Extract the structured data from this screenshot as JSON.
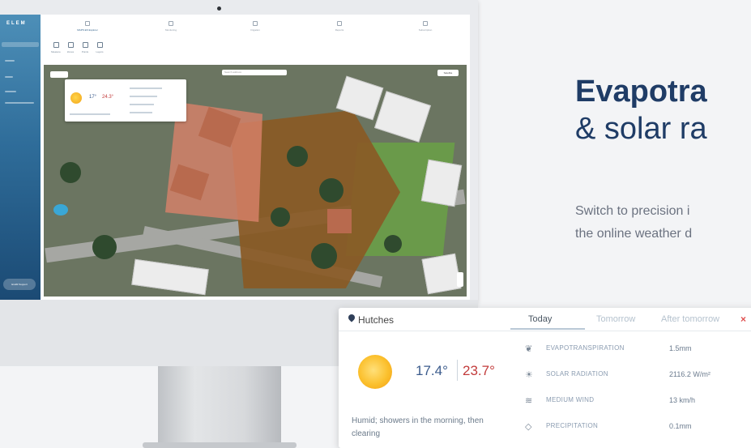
{
  "sidebar": {
    "logo": "ELEM",
    "support_label": "ELEM Support"
  },
  "topnav": {
    "tabs": [
      {
        "label": "MAPS EN Explorer"
      },
      {
        "label": "Monitoring"
      },
      {
        "label": "Irrigation"
      },
      {
        "label": "Reports"
      },
      {
        "label": "Subscription"
      }
    ]
  },
  "tools": [
    "Measure",
    "Zones",
    "Points",
    "Layers"
  ],
  "map": {
    "search_placeholder": "Search address",
    "satellite_label": "Satellite"
  },
  "mini_card": {
    "min": "17°",
    "max": "24.3°"
  },
  "heading": {
    "line1": "Evapotra",
    "line2": "& solar ra"
  },
  "paragraph": {
    "line1": "Switch to precision i",
    "line2": "the online weather d"
  },
  "card": {
    "location": "Hutches",
    "tabs": [
      "Today",
      "Tomorrow",
      "After tomorrow"
    ],
    "close": "×",
    "temp_min": "17.4°",
    "temp_max": "23.7°",
    "summary": "Humid; showers in the morning, then clearing",
    "rows": [
      {
        "icon": "evapotranspiration-icon",
        "glyph": "❦",
        "label": "EVAPOTRANSPIRATION",
        "value": "1.5mm"
      },
      {
        "icon": "sun-icon",
        "glyph": "☀",
        "label": "SOLAR RADIATION",
        "value": "2116.2 W/m²"
      },
      {
        "icon": "wind-icon",
        "glyph": "≋",
        "label": "MEDIUM WIND",
        "value": "13 km/h"
      },
      {
        "icon": "drop-icon",
        "glyph": "◇",
        "label": "PRECIPITATION",
        "value": "0.1mm"
      }
    ]
  },
  "colors": {
    "brand": "#1f3c66",
    "accent_red": "#e05050",
    "sidebar": "#2f6d9a"
  }
}
